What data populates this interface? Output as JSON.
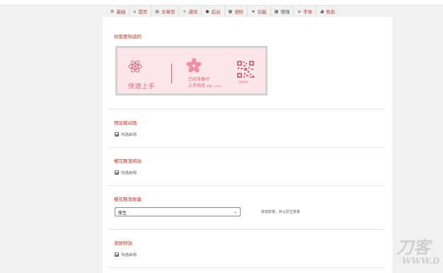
{
  "tabs": [
    {
      "icon": "gear-icon",
      "glyph": "⚙",
      "label": "基础"
    },
    {
      "icon": "home-icon",
      "glyph": "⌂",
      "label": "首页"
    },
    {
      "icon": "article-icon",
      "glyph": "▤",
      "label": "文章页"
    },
    {
      "icon": "share-icon",
      "glyph": "<",
      "label": "通讯"
    },
    {
      "icon": "user-icon",
      "glyph": "●",
      "label": "后台"
    },
    {
      "icon": "list-icon",
      "glyph": "▦",
      "label": "进阶"
    },
    {
      "icon": "star-icon",
      "glyph": "★",
      "label": "功能"
    },
    {
      "icon": "grid-icon",
      "glyph": "▦",
      "label": "增强"
    },
    {
      "icon": "font-icon",
      "glyph": "≡",
      "label": "字体"
    },
    {
      "icon": "palette-icon",
      "glyph": "◕",
      "label": "色彩"
    }
  ],
  "active_tab": "增强",
  "intro": {
    "title": "你需要知道的",
    "banner": {
      "quick_start": "快速上手",
      "ready": "已经准备好",
      "guide": "上手指南",
      "guide_note": "查看：yfx.cn",
      "qr_label": "扫码关注"
    }
  },
  "preload_anim": {
    "title": "预加载动画",
    "checkbox_label": "勾选启用",
    "checked": true
  },
  "sakura_effect": {
    "title": "樱花飘落特效",
    "checkbox_label": "勾选启用",
    "checked": true
  },
  "sakura_count": {
    "title": "樱花飘落数量",
    "selected": "原生",
    "hint": "飘落数量，默认原生数量"
  },
  "scroll_effect": {
    "title": "滚屏特效",
    "checkbox_label": "勾选启用",
    "checked": true
  },
  "watermark": {
    "line1": "刀客",
    "line2": "WWW.D"
  },
  "colors": {
    "accent": "#c0392b",
    "banner_bg": "#fde6e9",
    "pink": "#d86a7e"
  }
}
